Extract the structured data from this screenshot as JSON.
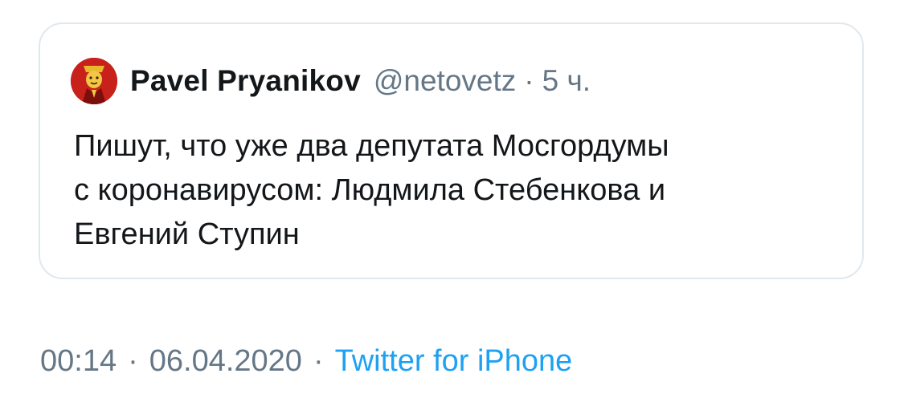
{
  "quoted_tweet": {
    "author_name": "Pavel Pryanikov",
    "author_handle": "@netovetz",
    "separator": "·",
    "time_ago": "5 ч.",
    "text": "Пишут, что уже два депутата Мосгордумы\nс коронавирусом: Людмила Стебенкова и\nЕвгений Ступин",
    "avatar_icon": "red-devil-avatar-icon"
  },
  "meta": {
    "time": "00:14",
    "separator": "·",
    "date": "06.04.2020",
    "source": "Twitter for iPhone"
  },
  "colors": {
    "text": "#14171a",
    "secondary": "#657786",
    "link": "#1da1f2",
    "border": "#e1e8ed"
  }
}
